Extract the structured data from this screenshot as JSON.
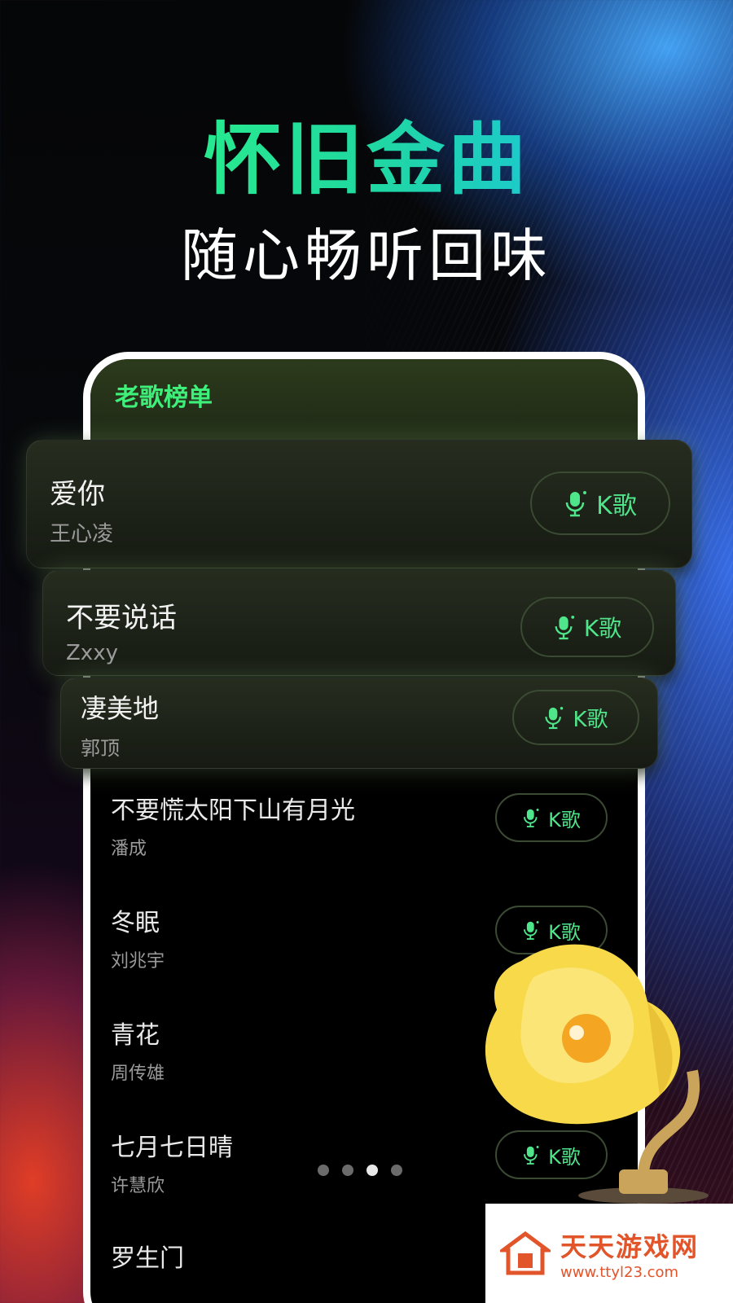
{
  "hero": {
    "title": "怀旧金曲",
    "subtitle": "随心畅听回味"
  },
  "chart": {
    "title": "老歌榜单",
    "button_label": "K歌",
    "songs": [
      {
        "title": "爱你",
        "artist": "王心凌"
      },
      {
        "title": "不要说话",
        "artist": "Zxxy"
      },
      {
        "title": "凄美地",
        "artist": "郭顶"
      },
      {
        "title": "不要慌太阳下山有月光",
        "artist": "潘成"
      },
      {
        "title": "冬眠",
        "artist": "刘兆宇"
      },
      {
        "title": "青花",
        "artist": "周传雄"
      },
      {
        "title": "七月七日晴",
        "artist": "许慧欣"
      },
      {
        "title": "罗生门",
        "artist": ""
      }
    ]
  },
  "pager": {
    "total": 4,
    "active_index": 3
  },
  "watermark": {
    "name": "天天游戏网",
    "url": "www.ttyl23.com"
  },
  "colors": {
    "accent_green": "#4fe58a",
    "title_green": "#30ff7a",
    "title_blue": "#18b8ff"
  }
}
